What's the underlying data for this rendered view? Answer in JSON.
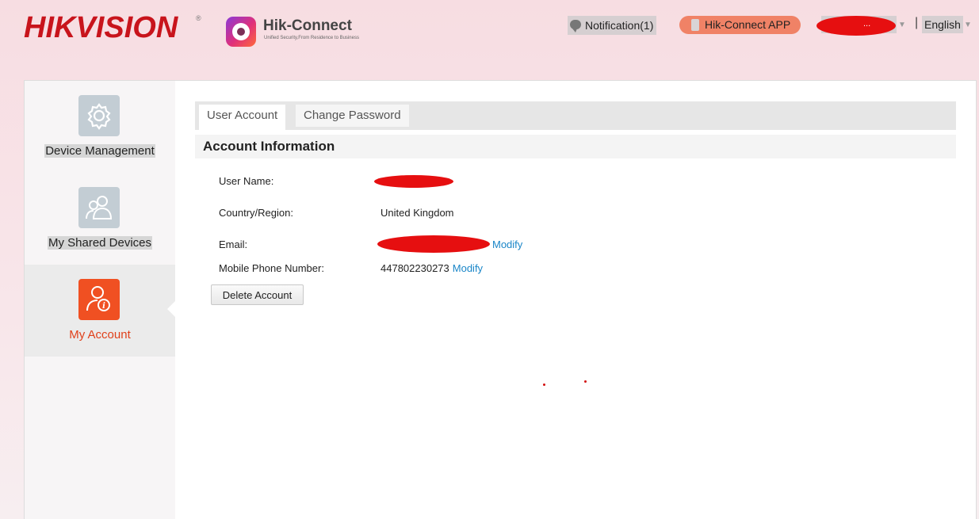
{
  "header": {
    "brand_main": "HIK",
    "brand_rest": "VISION",
    "registered_mark": "®",
    "app_title": "Hik-Connect",
    "app_subtitle": "Unified Security,From Residence to Business",
    "notification_label": "Notification(1)",
    "app_button_label": "Hik-Connect APP",
    "user_masked": "...",
    "separator": "|",
    "language": "English"
  },
  "sidebar": {
    "items": [
      {
        "label": "Device Management",
        "icon": "gear-icon",
        "active": false
      },
      {
        "label": "My Shared Devices",
        "icon": "users-icon",
        "active": false
      },
      {
        "label": "My Account",
        "icon": "account-info-icon",
        "active": true
      }
    ]
  },
  "tabs": [
    {
      "label": "User Account",
      "active": true
    },
    {
      "label": "Change Password",
      "active": false
    }
  ],
  "account": {
    "section_title": "Account Information",
    "user_name_label": "User Name:",
    "country_label": "Country/Region:",
    "country_value": "United Kingdom",
    "email_label": "Email:",
    "email_modify": "Modify",
    "phone_label": "Mobile Phone Number:",
    "phone_value": "447802230273",
    "phone_modify": "Modify",
    "delete_button": "Delete Account"
  },
  "colors": {
    "brand_red": "#c8141c",
    "accent_orange": "#f05022",
    "link_blue": "#1a86c8",
    "redaction_red": "#e60f10"
  }
}
